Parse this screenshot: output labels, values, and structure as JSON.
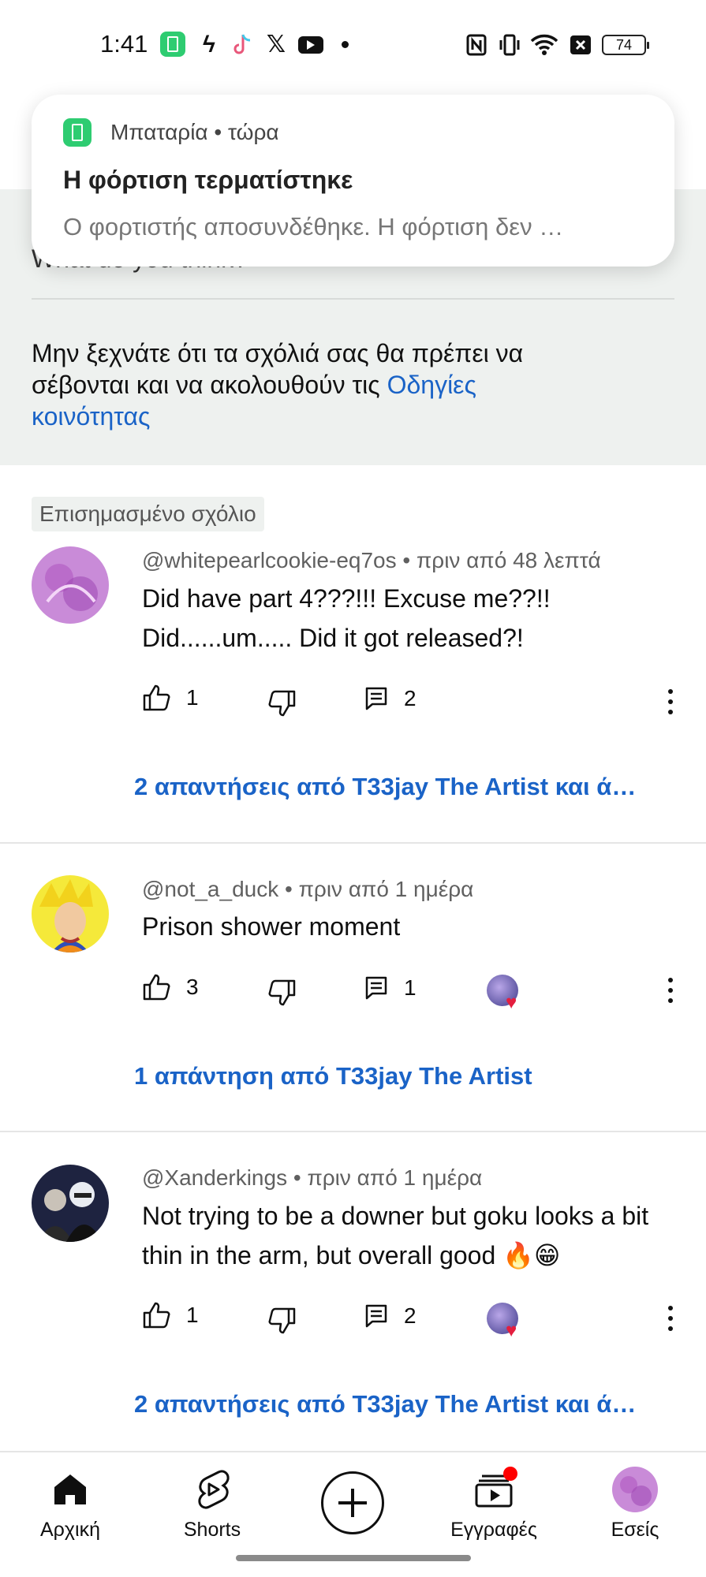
{
  "status_bar": {
    "time": "1:41",
    "battery_level": "74",
    "icons": [
      "battery-charge-app-icon",
      "flash-icon",
      "tiktok-icon",
      "x-icon",
      "youtube-icon",
      "dot-icon",
      "nfc-icon",
      "vibrate-icon",
      "wifi-icon",
      "no-sim-icon",
      "battery-icon"
    ]
  },
  "notification": {
    "app": "Μπαταρία • τώρα",
    "title": "Η φόρτιση τερματίστηκε",
    "body": "Ο φορτιστής αποσυνδέθηκε. Η φόρτιση δεν …"
  },
  "header": {
    "partial_text": "What do you think?",
    "guideline_text": "Μην ξεχνάτε ότι τα σχόλιά σας θα πρέπει να σέβονται και να ακολουθούν τις ",
    "guideline_link": "Οδηγίες κοινότητας"
  },
  "highlighted_badge": "Επισημασμένο σχόλιο",
  "comments": [
    {
      "meta": "@whitepearlcookie-eq7os • πριν από 48 λεπτά",
      "text": "Did have part 4???!!!  Excuse me??!! Did......um..... Did it got released?!",
      "likes": "1",
      "reply_count": "2",
      "creator_heart": false,
      "replies_label": "2 απαντήσεις από T33jay The Artist και ά…"
    },
    {
      "meta": "@not_a_duck • πριν από 1 ημέρα",
      "text": "Prison shower moment",
      "likes": "3",
      "reply_count": "1",
      "creator_heart": true,
      "replies_label": "1 απάντηση από T33jay The Artist"
    },
    {
      "meta": "@Xanderkings • πριν από 1 ημέρα",
      "text": "Not trying to be a downer but goku looks a bit thin in the arm, but overall good 🔥😁",
      "likes": "1",
      "reply_count": "2",
      "creator_heart": true,
      "replies_label": "2 απαντήσεις από T33jay The Artist και ά…"
    }
  ],
  "bottom_nav": {
    "home": "Αρχική",
    "shorts": "Shorts",
    "subscriptions": "Εγγραφές",
    "you": "Εσείς"
  },
  "colors": {
    "link_blue": "#1a63c7",
    "band_gray": "#eef1ef",
    "notification_dot": "#ff0000"
  }
}
